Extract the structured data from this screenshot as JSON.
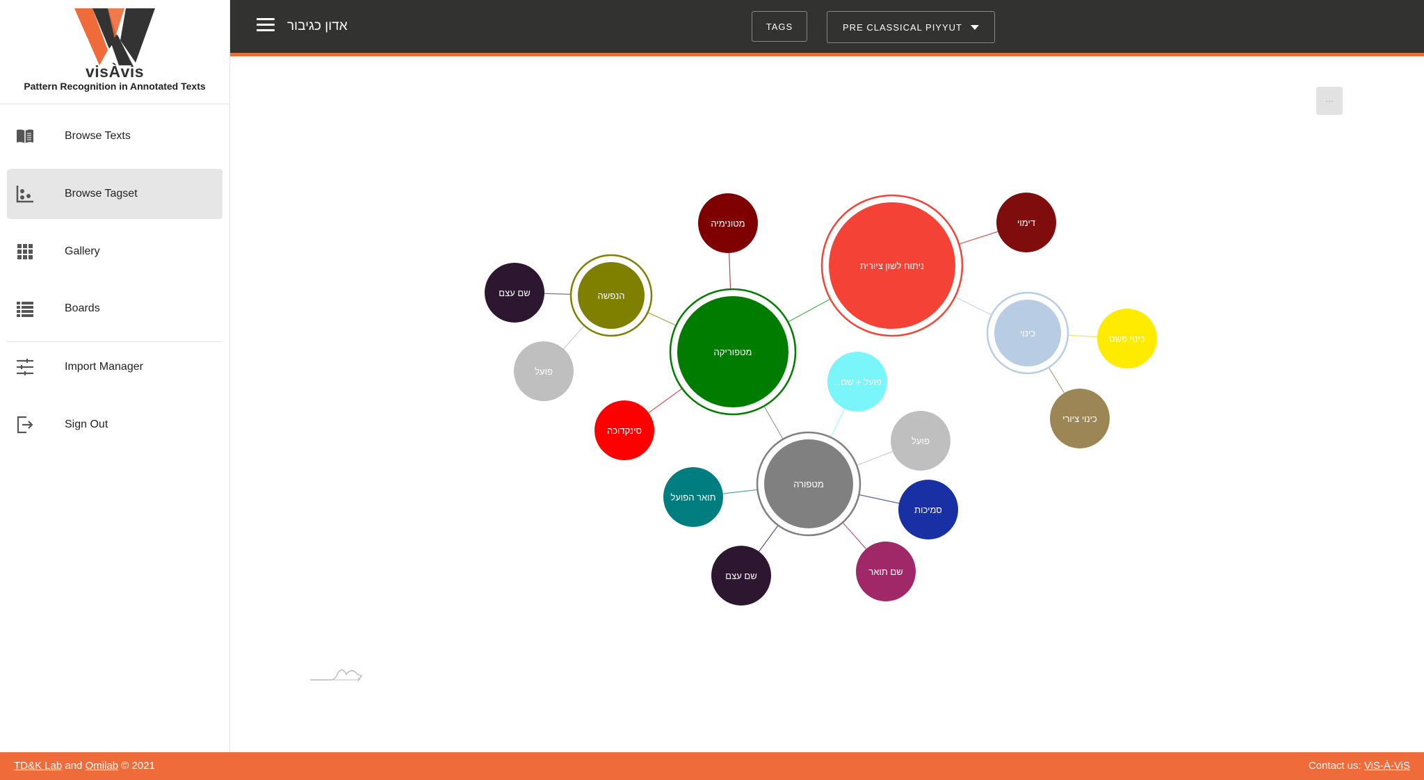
{
  "brand": {
    "name": "visÀvis",
    "tagline": "Pattern Recognition in Annotated Texts",
    "colors": {
      "orange": "#f06b3a",
      "dark": "#323330"
    }
  },
  "sidebar": {
    "items": [
      {
        "label": "Browse Texts",
        "icon": "book-open-icon",
        "active": false
      },
      {
        "label": "Browse Tagset",
        "icon": "scatter-chart-icon",
        "active": true
      },
      {
        "label": "Gallery",
        "icon": "grid-icon",
        "active": false
      },
      {
        "label": "Boards",
        "icon": "list-icon",
        "active": false
      },
      {
        "label": "Import Manager",
        "icon": "sliders-icon",
        "active": false
      },
      {
        "label": "Sign Out",
        "icon": "sign-out-icon",
        "active": false
      }
    ]
  },
  "topbar": {
    "title": "אדון כגיבור",
    "tags_label": "TAGS",
    "corpus_label": "PRE CLASSICAL PIYYUT"
  },
  "toolbar": {
    "more_label": "···"
  },
  "graph": {
    "nodes": [
      {
        "id": "nituach",
        "label": "ניתוח לשון ציורית",
        "color": "#f44336",
        "ring": true
      },
      {
        "id": "dimui",
        "label": "דימוי",
        "color": "#7f0d0d"
      },
      {
        "id": "kinui",
        "label": "כינוי",
        "color": "#b8cde3",
        "ring": true
      },
      {
        "id": "kinui-pashut",
        "label": "כינוי פשט",
        "color": "#ffeb00"
      },
      {
        "id": "kinui-tziuri",
        "label": "כינוי ציורי",
        "color": "#9c8656"
      },
      {
        "id": "metaforika",
        "label": "מטפוריקה",
        "color": "#007d00",
        "ring": true
      },
      {
        "id": "metonimia",
        "label": "מטונימיה",
        "color": "#7f0000"
      },
      {
        "id": "hanfasha",
        "label": "הנפשה",
        "color": "#7f8000",
        "ring": true
      },
      {
        "id": "shem-etzem-1",
        "label": "שם עצם",
        "color": "#2d1630"
      },
      {
        "id": "poal-1",
        "label": "פועל",
        "color": "#bfbfbf"
      },
      {
        "id": "sinekdocha",
        "label": "סינקדוכה",
        "color": "#ff0000"
      },
      {
        "id": "poal-shem",
        "label": "פועל + שם...",
        "color": "#7af5fa"
      },
      {
        "id": "metafora",
        "label": "מטפורה",
        "color": "#808080",
        "ring": true
      },
      {
        "id": "poal-2",
        "label": "פועל",
        "color": "#bfbfbf"
      },
      {
        "id": "smichut",
        "label": "סמיכות",
        "color": "#1830a4"
      },
      {
        "id": "shem-toar",
        "label": "שם תואר",
        "color": "#a02868"
      },
      {
        "id": "shem-etzem-2",
        "label": "שם עצם",
        "color": "#2d1630"
      },
      {
        "id": "toar-hapoal",
        "label": "תואר הפועל",
        "color": "#007d7e"
      }
    ]
  },
  "footer": {
    "lab1": "TD&K Lab",
    "and": "and",
    "lab2": "Omilab",
    "copyright": "© 2021",
    "contact_label": "Contact us:",
    "contact_link": "ViS-À-ViS"
  }
}
